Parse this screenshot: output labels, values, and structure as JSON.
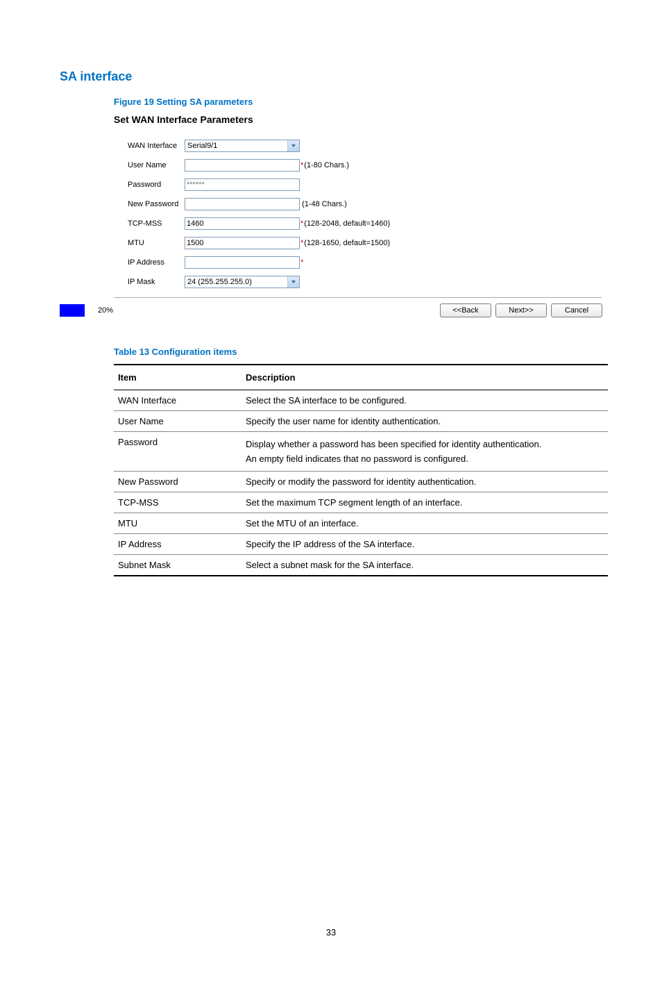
{
  "section_heading": "SA interface",
  "figure_caption": "Figure 19 Setting SA parameters",
  "panel_heading": "Set WAN Interface Parameters",
  "form": {
    "wan_interface": {
      "label": "WAN Interface",
      "value": "Serial9/1"
    },
    "user_name": {
      "label": "User Name",
      "value": "",
      "hint": "(1-80 Chars.)",
      "required": true
    },
    "password": {
      "label": "Password",
      "value": "******"
    },
    "new_password": {
      "label": "New Password",
      "value": "",
      "hint": "(1-48 Chars.)",
      "required": false
    },
    "tcp_mss": {
      "label": "TCP-MSS",
      "value": "1460",
      "hint": "(128-2048, default=1460)",
      "required": true
    },
    "mtu": {
      "label": "MTU",
      "value": "1500",
      "hint": "(128-1650, default=1500)",
      "required": true
    },
    "ip_address": {
      "label": "IP Address",
      "value": "",
      "required": true
    },
    "ip_mask": {
      "label": "IP Mask",
      "value": "24 (255.255.255.0)"
    }
  },
  "progress": {
    "percent_label": "20%",
    "fill_fraction": 0.2
  },
  "buttons": {
    "back": "<<Back",
    "next": "Next>>",
    "cancel": "Cancel"
  },
  "table_caption": "Table 13 Configuration items",
  "table_headers": {
    "item": "Item",
    "description": "Description"
  },
  "table_rows": [
    {
      "item": "WAN Interface",
      "description": "Select the SA interface to be configured."
    },
    {
      "item": "User Name",
      "description": "Specify the user name for identity authentication."
    },
    {
      "item": "Password",
      "description_line1": "Display whether a password has been specified for identity authentication.",
      "description_line2": "An empty field indicates that no password is configured."
    },
    {
      "item": "New Password",
      "description": "Specify or modify the password for identity authentication."
    },
    {
      "item": "TCP-MSS",
      "description": "Set the maximum TCP segment length of an interface."
    },
    {
      "item": "MTU",
      "description": "Set the MTU of an interface."
    },
    {
      "item": "IP Address",
      "description": "Specify the IP address of the SA interface."
    },
    {
      "item": "Subnet Mask",
      "description": "Select a subnet mask for the SA interface."
    }
  ],
  "page_number": "33"
}
